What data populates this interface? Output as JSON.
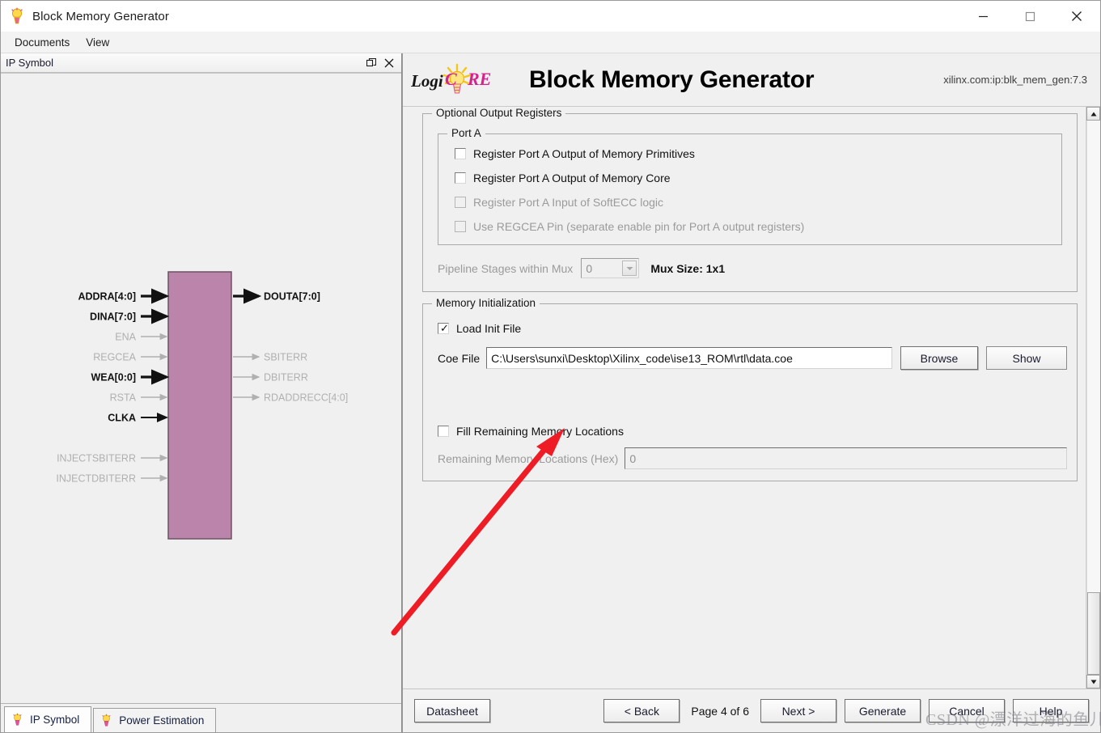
{
  "window": {
    "title": "Block Memory Generator",
    "icon": "lightbulb-icon",
    "minimize_label": "—",
    "maximize_label": "☐",
    "close_label": "✕"
  },
  "menubar": {
    "items": [
      {
        "label": "Documents"
      },
      {
        "label": "View"
      }
    ]
  },
  "ip_symbol_dock": {
    "title": "IP Symbol",
    "undock_icon": "undock-icon",
    "close_icon": "close-icon"
  },
  "symbol": {
    "block_color": "#bb85ab",
    "inputs": [
      {
        "label": "ADDRA[4:0]",
        "enabled": true,
        "bus": true
      },
      {
        "label": "DINA[7:0]",
        "enabled": true,
        "bus": true
      },
      {
        "label": "ENA",
        "enabled": false,
        "bus": false
      },
      {
        "label": "REGCEA",
        "enabled": false,
        "bus": false
      },
      {
        "label": "WEA[0:0]",
        "enabled": true,
        "bus": true
      },
      {
        "label": "RSTA",
        "enabled": false,
        "bus": false
      },
      {
        "label": "CLKA",
        "enabled": true,
        "bus": false
      }
    ],
    "inputs_lower": [
      {
        "label": "INJECTSBITERR",
        "enabled": false,
        "bus": false
      },
      {
        "label": "INJECTDBITERR",
        "enabled": false,
        "bus": false
      }
    ],
    "outputs": [
      {
        "label": "DOUTA[7:0]",
        "enabled": true,
        "bus": true
      },
      {
        "label": "SBITERR",
        "enabled": false,
        "bus": false
      },
      {
        "label": "DBITERR",
        "enabled": false,
        "bus": false
      },
      {
        "label": "RDADDRECC[4:0]",
        "enabled": false,
        "bus": true
      }
    ]
  },
  "bottom_tabs": [
    {
      "label": "IP Symbol",
      "icon": "lightbulb-icon",
      "active": true
    },
    {
      "label": "Power Estimation",
      "icon": "lightbulb-icon",
      "active": false
    }
  ],
  "core_header": {
    "logo_text_left": "Logi",
    "logo_text_right": "CORE",
    "title": "Block Memory Generator",
    "version": "xilinx.com:ip:blk_mem_gen:7.3"
  },
  "optional_output_registers": {
    "legend": "Optional Output Registers",
    "port_a": {
      "legend": "Port A",
      "checkboxes": [
        {
          "label": "Register Port A Output of Memory Primitives",
          "checked": false,
          "enabled": true
        },
        {
          "label": "Register Port A Output of Memory Core",
          "checked": false,
          "enabled": true
        },
        {
          "label": "Register Port A Input of SoftECC logic",
          "checked": false,
          "enabled": false
        },
        {
          "label": "Use REGCEA Pin (separate enable pin for Port A output registers)",
          "checked": false,
          "enabled": false
        }
      ]
    },
    "pipeline_label": "Pipeline Stages within Mux",
    "pipeline_value": "0",
    "pipeline_options": [
      "0"
    ],
    "mux_size_label": "Mux Size: 1x1"
  },
  "memory_initialization": {
    "legend": "Memory Initialization",
    "load_init_file": {
      "label": "Load Init File",
      "checked": true,
      "enabled": true
    },
    "coe_file_label": "Coe File",
    "coe_file_value": "C:\\Users\\sunxi\\Desktop\\Xilinx_code\\ise13_ROM\\rtl\\data.coe",
    "browse_label": "Browse",
    "show_label": "Show",
    "fill_remaining": {
      "label": "Fill Remaining Memory Locations",
      "checked": false,
      "enabled": true
    },
    "remaining_label": "Remaining Memory Locations (Hex)",
    "remaining_value": "0",
    "remaining_enabled": false
  },
  "wizard_bar": {
    "datasheet_label": "Datasheet",
    "back_label": "< Back",
    "page_indicator": "Page 4 of 6",
    "next_label": "Next >",
    "generate_label": "Generate",
    "cancel_label": "Cancel",
    "help_label": "Help"
  },
  "annotation": {
    "arrow_color": "#ee1c25",
    "watermark": "CSDN @漂洋过海的鱼儿"
  },
  "scrollbar": {
    "up_glyph": "▲",
    "down_glyph": "▼"
  }
}
